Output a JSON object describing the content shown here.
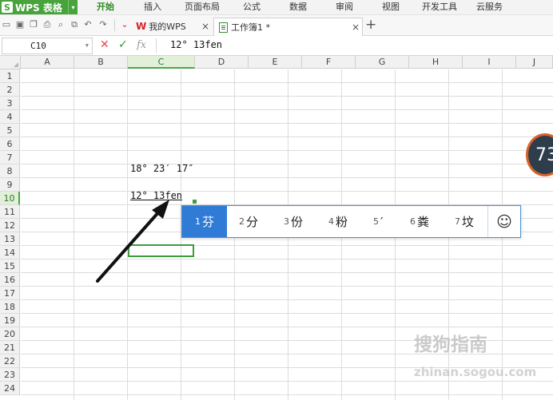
{
  "menubar": {
    "app_logo": "S",
    "app_name": "WPS 表格",
    "items": [
      "开始",
      "插入",
      "页面布局",
      "公式",
      "数据",
      "审阅",
      "视图",
      "开发工具",
      "云服务"
    ]
  },
  "doc_tabs": [
    {
      "label": "我的WPS",
      "close": "×"
    },
    {
      "label": "工作簿1 *",
      "close": "×"
    }
  ],
  "add_tab": "+",
  "formula_bar": {
    "name_box": "C10",
    "cancel": "✕",
    "confirm": "✓",
    "fx": "fx",
    "value": "12° 13fen"
  },
  "grid": {
    "columns": [
      "A",
      "B",
      "C",
      "D",
      "E",
      "F",
      "G",
      "H",
      "I",
      "J"
    ],
    "rows": [
      "1",
      "2",
      "3",
      "4",
      "5",
      "6",
      "7",
      "8",
      "9",
      "10",
      "11",
      "12",
      "13",
      "14",
      "15",
      "16",
      "17",
      "18",
      "19",
      "20",
      "21",
      "22",
      "23",
      "24"
    ],
    "selected_column": "C",
    "selected_row": "10",
    "cells": {
      "C8": "18° 23′ 17″",
      "C10": "12° 13fen"
    }
  },
  "ime": {
    "candidates": [
      {
        "num": "1",
        "text": "芬"
      },
      {
        "num": "2",
        "text": "分"
      },
      {
        "num": "3",
        "text": "份"
      },
      {
        "num": "4",
        "text": "粉"
      },
      {
        "num": "5",
        "text": "′"
      },
      {
        "num": "6",
        "text": "粪"
      },
      {
        "num": "7",
        "text": "坟"
      }
    ],
    "emoji": "☺"
  },
  "overlay": {
    "badge_text": "73",
    "watermark": "搜狗指南",
    "watermark_url": "zhinan.sogou.com"
  },
  "colors": {
    "accent_green": "#49a33d",
    "ime_selected": "#2f7bd6",
    "wps_red": "#d3232a"
  }
}
